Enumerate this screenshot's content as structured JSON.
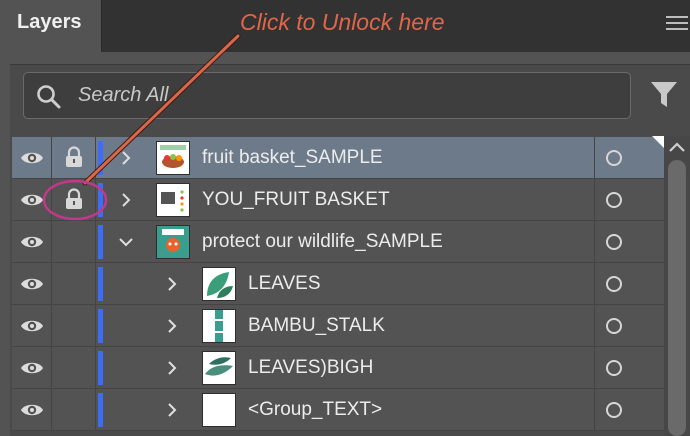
{
  "panel": {
    "tab_label": "Layers"
  },
  "annotation": {
    "text": "Click to Unlock here"
  },
  "search": {
    "placeholder": "Search All"
  },
  "colors": {
    "annotation": "#e0654a",
    "selection": "#6d7a8a",
    "layer_color": "#3e6df5",
    "highlight_circle": "#c0398a"
  },
  "layers": [
    {
      "name": "fruit basket_SAMPLE",
      "locked": true,
      "visible": true,
      "expanded": false,
      "selected": true,
      "level": 0,
      "thumb": "fruit-basket-sample-thumb"
    },
    {
      "name": "YOU_FRUIT BASKET",
      "locked": true,
      "visible": true,
      "expanded": false,
      "selected": false,
      "level": 0,
      "thumb": "you-fruit-basket-thumb"
    },
    {
      "name": "protect our wildlife_SAMPLE",
      "locked": false,
      "visible": true,
      "expanded": true,
      "selected": false,
      "level": 0,
      "thumb": "wildlife-thumb"
    },
    {
      "name": "LEAVES",
      "locked": false,
      "visible": true,
      "expanded": false,
      "selected": false,
      "level": 1,
      "thumb": "leaves-thumb"
    },
    {
      "name": "BAMBU_STALK",
      "locked": false,
      "visible": true,
      "expanded": false,
      "selected": false,
      "level": 1,
      "thumb": "bamboo-thumb"
    },
    {
      "name": "LEAVES)BIGH",
      "locked": false,
      "visible": true,
      "expanded": false,
      "selected": false,
      "level": 1,
      "thumb": "leaves-big-thumb"
    },
    {
      "name": "<Group_TEXT>",
      "locked": false,
      "visible": true,
      "expanded": false,
      "selected": false,
      "level": 1,
      "thumb": "group-text-thumb"
    }
  ]
}
